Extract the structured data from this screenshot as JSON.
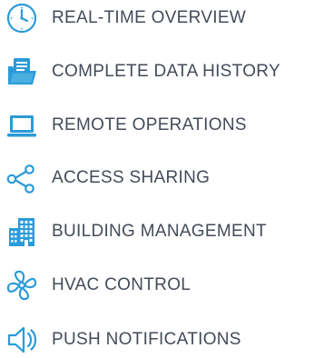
{
  "theme": {
    "text_color": "#444b59",
    "icon_color": "#2b9bd8",
    "background": "#ffffff"
  },
  "features": [
    {
      "label": "REAL-TIME OVERVIEW",
      "icon": "clock-icon"
    },
    {
      "label": "COMPLETE DATA HISTORY",
      "icon": "folder-document-icon"
    },
    {
      "label": "REMOTE OPERATIONS",
      "icon": "laptop-icon"
    },
    {
      "label": "ACCESS SHARING",
      "icon": "share-icon"
    },
    {
      "label": "BUILDING MANAGEMENT",
      "icon": "building-icon"
    },
    {
      "label": "HVAC CONTROL",
      "icon": "fan-icon"
    },
    {
      "label": "PUSH NOTIFICATIONS",
      "icon": "speaker-icon"
    }
  ]
}
